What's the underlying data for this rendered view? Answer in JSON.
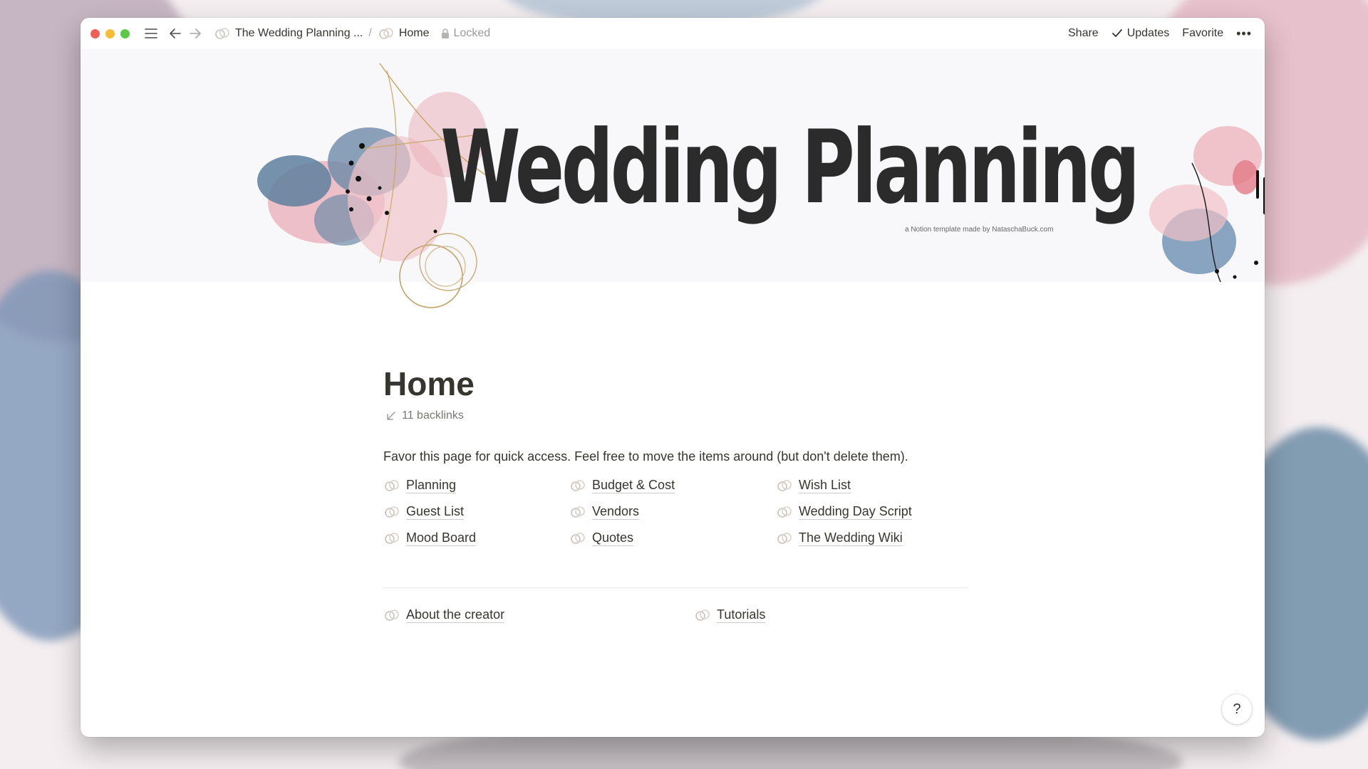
{
  "window": {
    "breadcrumb": {
      "workspace": "The Wedding Planning ...",
      "separator": "/",
      "page": "Home",
      "locked_label": "Locked"
    },
    "actions": {
      "share": "Share",
      "updates": "Updates",
      "favorite": "Favorite",
      "more": "•••"
    }
  },
  "cover": {
    "title": "Wedding Planning",
    "credit": "a Notion template made by NataschaBuck.com"
  },
  "page": {
    "title": "Home",
    "backlinks": "11 backlinks",
    "description": "Favor this page for quick access. Feel free to move the items around (but don't delete them).",
    "links": [
      "Planning",
      "Budget & Cost",
      "Wish List",
      "Guest List",
      "Vendors",
      "Wedding Day Script",
      "Mood Board",
      "Quotes",
      "The Wedding Wiki"
    ],
    "bottom_links": [
      "About the creator",
      "Tutorials"
    ]
  },
  "help": "?",
  "colors": {
    "rose": "#e6a9b3",
    "slate_blue": "#5d7fa0",
    "gold": "#c9a867",
    "text": "#37352f"
  }
}
